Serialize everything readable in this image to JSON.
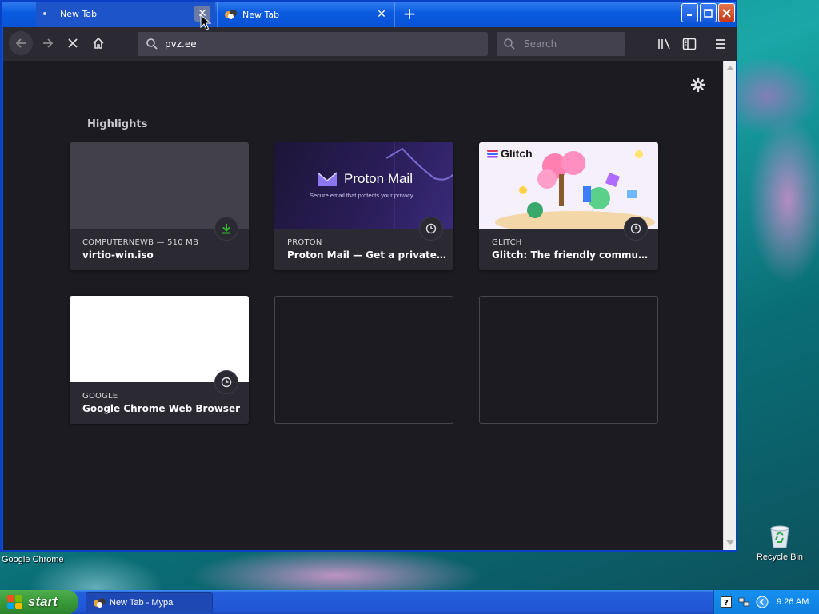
{
  "browser": {
    "tabs": [
      {
        "title": "New Tab",
        "active": true
      },
      {
        "title": "New Tab",
        "active": false
      }
    ],
    "url": "pvz.ee",
    "search_placeholder": "Search"
  },
  "newtab": {
    "highlights_title": "Highlights",
    "cards": [
      {
        "source": "COMPUTERNEWB — 510 MB",
        "title": "virtio-win.iso",
        "badge": "download-icon"
      },
      {
        "source": "PROTON",
        "title": "Proton Mail — Get a private, sec…",
        "badge": "clock-icon",
        "thumb_brand": "Proton Mail",
        "thumb_tagline": "Secure email that protects your privacy"
      },
      {
        "source": "GLITCH",
        "title": "Glitch: The friendly community …",
        "badge": "clock-icon",
        "thumb_brand": "Glitch"
      },
      {
        "source": "GOOGLE",
        "title": "Google Chrome Web Browser",
        "badge": "clock-icon"
      }
    ]
  },
  "desktop": {
    "status_text": "Google Chrome",
    "recycle_bin_label": "Recycle Bin"
  },
  "taskbar": {
    "start_label": "start",
    "task_item_label": "New Tab - Mypal",
    "clock": "9:26 AM"
  },
  "colors": {
    "titlebar": "#0a5ae0",
    "toolbar": "#2b2a33",
    "content_bg": "#1c1b22",
    "card_bg": "#2b2a33",
    "download_green": "#2ac02a",
    "start_green": "#389a38"
  }
}
